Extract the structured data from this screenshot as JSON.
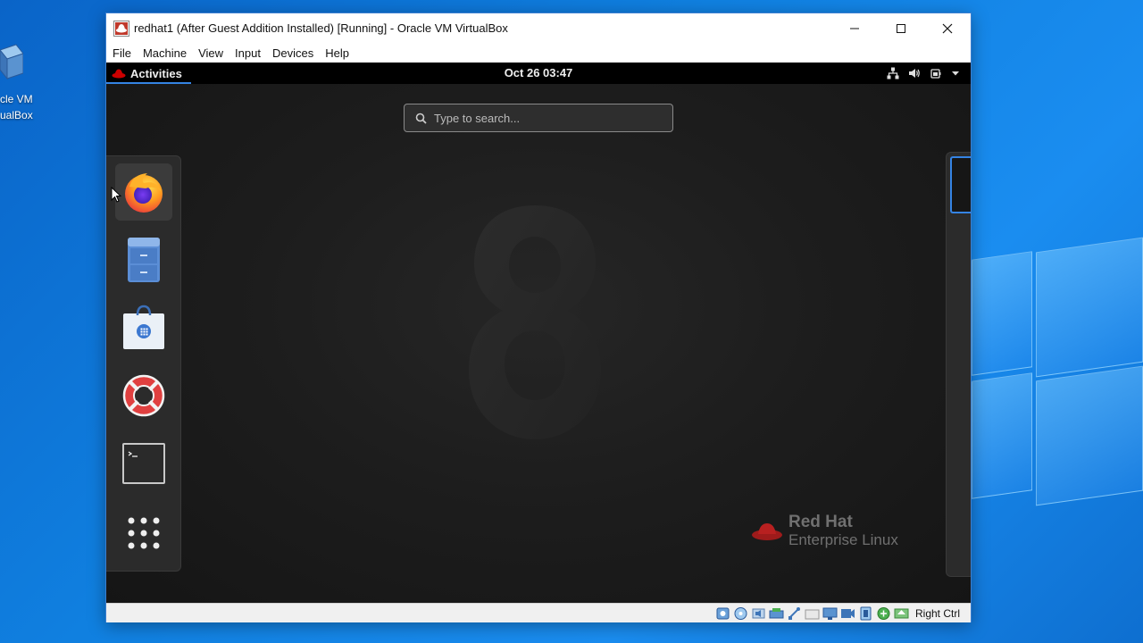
{
  "window": {
    "title": "redhat1 (After Guest Addition Installed) [Running] - Oracle VM VirtualBox"
  },
  "menu": [
    "File",
    "Machine",
    "View",
    "Input",
    "Devices",
    "Help"
  ],
  "desktop_icon": {
    "label": "cle VM\nualBox"
  },
  "guest": {
    "topbar": {
      "activities": "Activities",
      "clock": "Oct 26  03:47"
    },
    "search": {
      "placeholder": "Type to search..."
    },
    "dash": [
      {
        "name": "Firefox",
        "icon": "firefox-icon"
      },
      {
        "name": "Files",
        "icon": "file-cabinet-icon"
      },
      {
        "name": "Software",
        "icon": "software-bag-icon"
      },
      {
        "name": "Help",
        "icon": "lifebuoy-icon"
      },
      {
        "name": "Terminal",
        "icon": "terminal-icon"
      },
      {
        "name": "Show Applications",
        "icon": "app-grid-icon"
      }
    ],
    "brand": {
      "line1": "Red Hat",
      "line2": "Enterprise Linux"
    }
  },
  "statusbar": {
    "hostkey": "Right Ctrl"
  },
  "colors": {
    "accent": "#3584e4",
    "redhat": "#cc0000",
    "desktop": "#1080e0"
  }
}
